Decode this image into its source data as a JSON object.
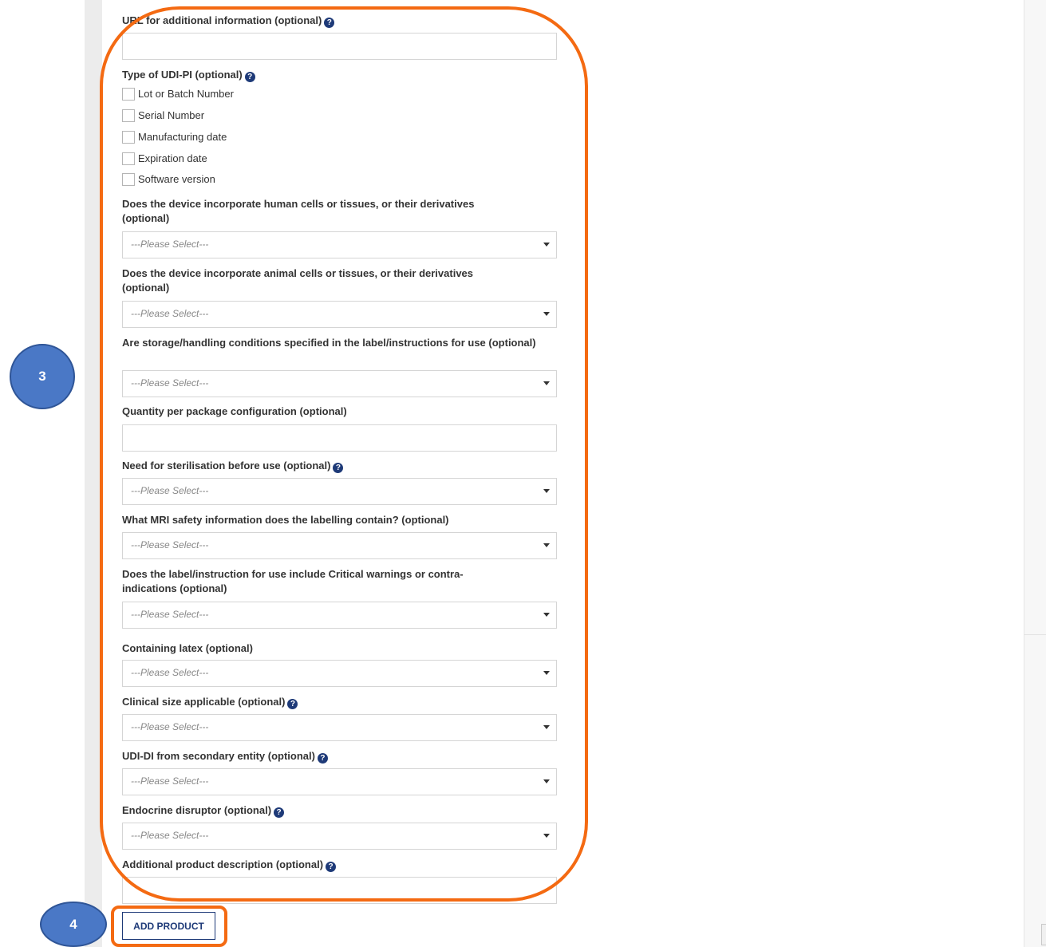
{
  "form": {
    "url_label": "URL for additional information (optional)",
    "udi_pi_label": "Type of UDI-PI (optional)",
    "udi_pi_options": [
      "Lot or Batch Number",
      "Serial Number",
      "Manufacturing date",
      "Expiration date",
      "Software version"
    ],
    "human_cells_label": "Does the device incorporate human cells or tissues, or their derivatives (optional)",
    "animal_cells_label": "Does the device incorporate animal cells or tissues, or their derivatives (optional)",
    "storage_label": "Are storage/handling conditions specified in the label/instructions for use (optional)",
    "quantity_label": "Quantity per package configuration (optional)",
    "sterilisation_label": "Need for sterilisation before use (optional)",
    "mri_label": "What MRI safety information does the labelling contain? (optional)",
    "warnings_label": "Does the label/instruction for use include Critical warnings or contra-indications (optional)",
    "latex_label": "Containing latex (optional)",
    "clinical_size_label": "Clinical size applicable (optional)",
    "secondary_entity_label": "UDI-DI from secondary entity (optional)",
    "endocrine_label": "Endocrine disruptor (optional)",
    "additional_desc_label": "Additional product description (optional)",
    "select_placeholder": "---Please Select---",
    "add_product_label": "ADD PRODUCT"
  },
  "annotations": {
    "step3": "3",
    "step4": "4",
    "highlight_color": "#f46a12",
    "badge_color": "#4a78c6"
  },
  "icons": {
    "help": "question-circle-icon",
    "dropdown": "caret-down-icon"
  }
}
